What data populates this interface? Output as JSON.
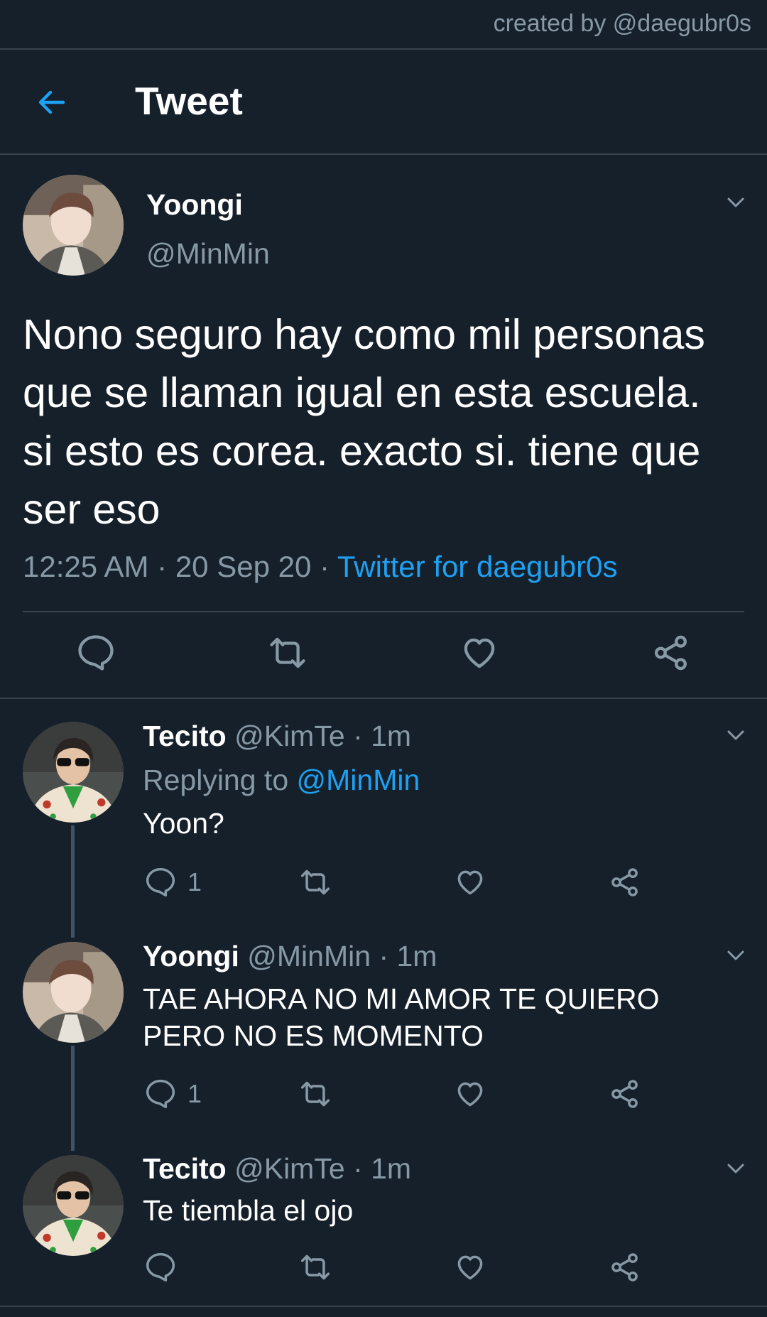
{
  "watermark": "created by @daegubr0s",
  "header": {
    "title": "Tweet",
    "back_icon": "arrow-left-icon"
  },
  "colors": {
    "background": "#15202b",
    "accent": "#1da1f2",
    "muted": "#8899a6",
    "divider": "#38444d"
  },
  "main_tweet": {
    "name": "Yoongi",
    "handle": "@MinMin",
    "text": "Nono seguro hay como mil personas que se llaman igual en esta escuela. si esto es corea. exacto si. tiene que ser eso",
    "time": "12:25 AM",
    "date": "20 Sep 20",
    "separator": "·",
    "source": "Twitter for daegubr0s",
    "actions": [
      "reply-icon",
      "retweet-icon",
      "like-icon",
      "share-icon"
    ]
  },
  "replies": [
    {
      "name": "Tecito",
      "handle": "@KimTe",
      "time": "· 1m",
      "replying_label": "Replying to",
      "replying_to": "@MinMin",
      "text": "Yoon?",
      "reply_count": "1"
    },
    {
      "name": "Yoongi",
      "handle": "@MinMin",
      "time": "· 1m",
      "text": "TAE AHORA NO MI AMOR TE QUIERO PERO NO ES MOMENTO",
      "reply_count": "1"
    },
    {
      "name": "Tecito",
      "handle": "@KimTe",
      "time": "· 1m",
      "text": "Te tiembla el ojo",
      "reply_count": ""
    }
  ]
}
